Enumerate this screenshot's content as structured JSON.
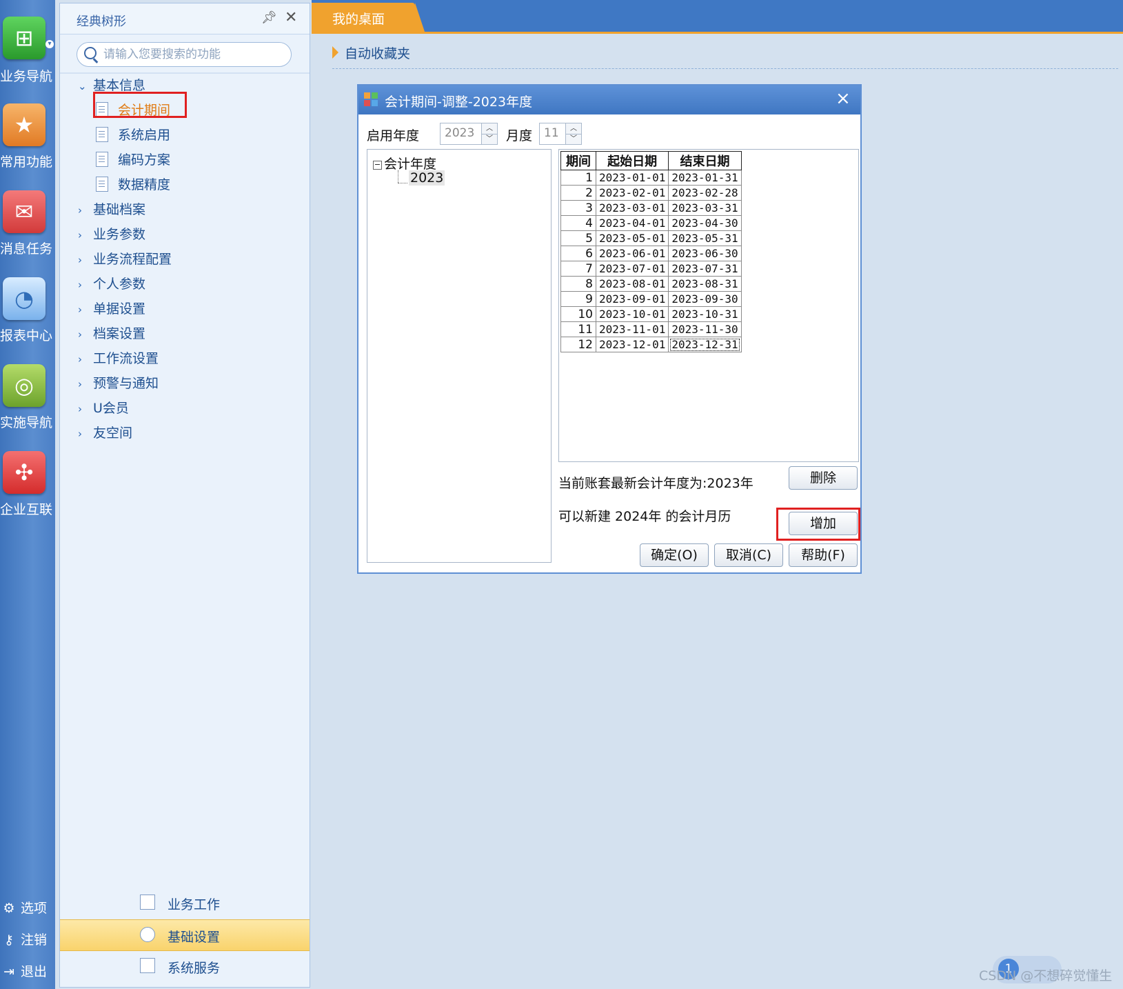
{
  "rail": {
    "items": [
      {
        "label": "业务导航",
        "icon": "navigation-tree-icon",
        "color": "#38a83a"
      },
      {
        "label": "常用功能",
        "icon": "star-icon",
        "color": "#e8892b"
      },
      {
        "label": "消息任务",
        "icon": "envelope-icon",
        "color": "#e04848"
      },
      {
        "label": "报表中心",
        "icon": "report-chart-icon",
        "color": "#5aa0e0"
      },
      {
        "label": "实施导航",
        "icon": "compass-icon",
        "color": "#8ab83a"
      },
      {
        "label": "企业互联",
        "icon": "connect-icon",
        "color": "#e44a48"
      }
    ],
    "bottom": [
      {
        "label": "选项",
        "icon": "gear-icon"
      },
      {
        "label": "注销",
        "icon": "key-icon"
      },
      {
        "label": "退出",
        "icon": "exit-icon"
      }
    ]
  },
  "panel": {
    "title": "经典树形",
    "search_placeholder": "请输入您要搜索的功能",
    "tree": {
      "expanded": {
        "label": "基本信息",
        "children": [
          "会计期间",
          "系统启用",
          "编码方案",
          "数据精度"
        ],
        "active": "会计期间"
      },
      "collapsed": [
        "基础档案",
        "业务参数",
        "业务流程配置",
        "个人参数",
        "单据设置",
        "档案设置",
        "工作流设置",
        "预警与通知",
        "U会员",
        "友空间"
      ]
    },
    "bottom_tabs": [
      "业务工作",
      "基础设置",
      "系统服务"
    ],
    "selected_tab": "基础设置"
  },
  "main": {
    "tab": "我的桌面",
    "favorites": "自动收藏夹"
  },
  "dialog": {
    "title": "会计期间-调整-2023年度",
    "year_label": "启用年度",
    "year_value": "2023",
    "month_label": "月度",
    "month_value": "11",
    "tree_root": "会计年度",
    "tree_child": "2023",
    "table": {
      "headers": [
        "期间",
        "起始日期",
        "结束日期"
      ],
      "rows": [
        [
          "1",
          "2023-01-01",
          "2023-01-31"
        ],
        [
          "2",
          "2023-02-01",
          "2023-02-28"
        ],
        [
          "3",
          "2023-03-01",
          "2023-03-31"
        ],
        [
          "4",
          "2023-04-01",
          "2023-04-30"
        ],
        [
          "5",
          "2023-05-01",
          "2023-05-31"
        ],
        [
          "6",
          "2023-06-01",
          "2023-06-30"
        ],
        [
          "7",
          "2023-07-01",
          "2023-07-31"
        ],
        [
          "8",
          "2023-08-01",
          "2023-08-31"
        ],
        [
          "9",
          "2023-09-01",
          "2023-09-30"
        ],
        [
          "10",
          "2023-10-01",
          "2023-10-31"
        ],
        [
          "11",
          "2023-11-01",
          "2023-11-30"
        ],
        [
          "12",
          "2023-12-01",
          "2023-12-31"
        ]
      ]
    },
    "latest_year_text": "当前账套最新会计年度为:2023年",
    "can_create_text": "可以新建 2024年 的会计月历",
    "delete_button": "删除",
    "add_button": "增加",
    "ok_button": "确定(O)",
    "cancel_button": "取消(C)",
    "help_button": "帮助(F)"
  },
  "watermark": "CSDN @不想碎觉懂生",
  "badge_count": "1"
}
